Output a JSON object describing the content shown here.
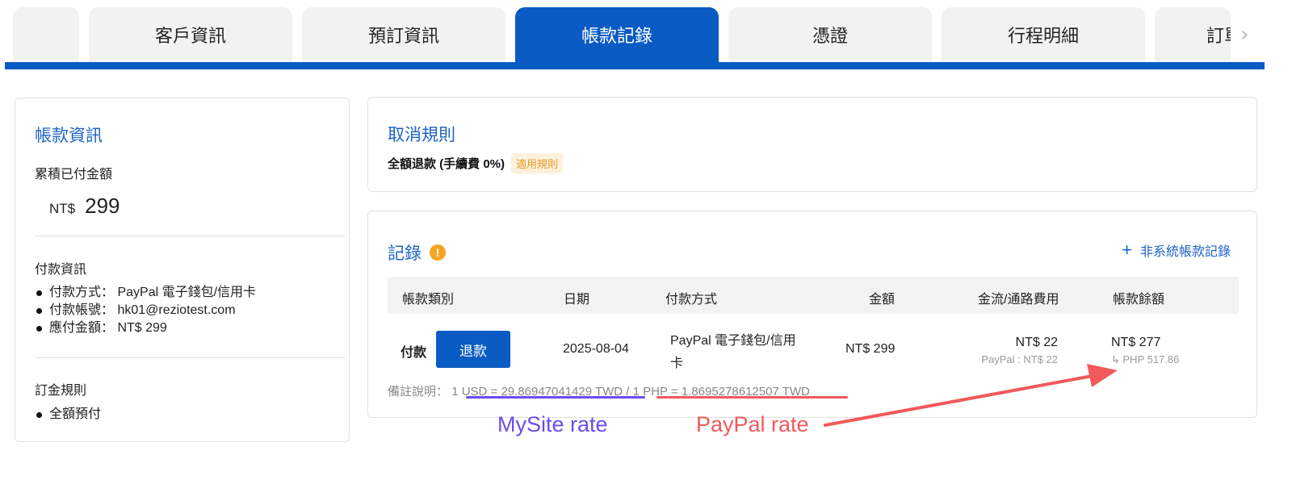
{
  "tabs": {
    "items": [
      {
        "label": ""
      },
      {
        "label": "客戶資訊"
      },
      {
        "label": "預訂資訊"
      },
      {
        "label": "帳款記錄"
      },
      {
        "label": "憑證"
      },
      {
        "label": "行程明細"
      },
      {
        "label": "訂單"
      }
    ],
    "prev_arrow": "‹",
    "next_arrow": "›"
  },
  "billing": {
    "title": "帳款資訊",
    "paid_label": "累積已付金額",
    "paid_currency": "NT$",
    "paid_value": "299",
    "payment_info_label": "付款資訊",
    "payment_items": [
      "付款方式： PayPal 電子錢包/信用卡",
      "付款帳號： hk01@reziotest.com",
      "應付金額： NT$ 299"
    ],
    "deposit_label": "訂金規則",
    "deposit_items": [
      "全額預付"
    ]
  },
  "cancel": {
    "title": "取消規則",
    "rule": "全額退款 (手續費 0%)",
    "badge": "適用規則"
  },
  "records": {
    "title": "記錄",
    "warn": "!",
    "add_plus": "+",
    "add_label": "非系統帳款記錄",
    "columns": [
      "帳款類別",
      "日期",
      "付款方式",
      "金額",
      "金流/通路費用",
      "帳款餘額"
    ],
    "row": {
      "type": "付款",
      "action": "退款",
      "date": "2025-08-04",
      "method_line1": "PayPal 電子錢包/信用",
      "method_line2": "卡",
      "amount": "NT$ 299",
      "fee": "NT$ 22",
      "fee_sub": "PayPal : NT$ 22",
      "balance": "NT$ 277",
      "balance_sub": "↳ PHP 517.86"
    },
    "remark_label": "備註說明：",
    "rate_usd": "1 USD = 29.86947041429 TWD",
    "rate_sep": " / ",
    "rate_php": "1 PHP = 1.8695278612507 TWD"
  },
  "annotations": {
    "mysite_label": "MySite rate",
    "paypal_label": "PayPal rate",
    "mysite_color": "#6b4bf0",
    "paypal_color": "#f05a5a"
  },
  "colors": {
    "primary": "#0a5bc4",
    "link": "#1e63c5",
    "warn": "#f5a524"
  }
}
